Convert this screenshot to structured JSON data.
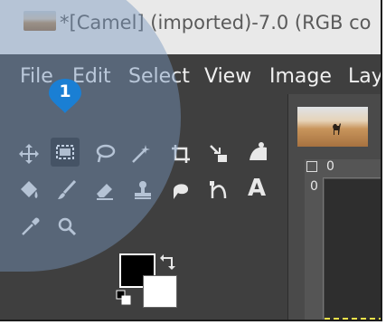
{
  "window": {
    "title": "*[Camel] (imported)-7.0 (RGB co",
    "thumbnail_icon": "camel-image-thumbnail"
  },
  "menubar": {
    "items": [
      "File",
      "Edit",
      "Select",
      "View",
      "Image",
      "Lay"
    ]
  },
  "annotation": {
    "step_number": "1",
    "color": "#1a7fd4"
  },
  "toolbox": {
    "tools": [
      {
        "name": "move-tool",
        "icon": "move-arrows-icon"
      },
      {
        "name": "rect-select-tool",
        "icon": "rect-select-icon",
        "selected": true
      },
      {
        "name": "free-select-tool",
        "icon": "lasso-icon"
      },
      {
        "name": "fuzzy-select-tool",
        "icon": "magic-wand-icon"
      },
      {
        "name": "crop-tool",
        "icon": "crop-icon"
      },
      {
        "name": "unified-transform-tool",
        "icon": "transform-icon"
      },
      {
        "name": "warp-transform-tool",
        "icon": "warp-icon"
      },
      {
        "name": "bucket-fill-tool",
        "icon": "bucket-icon"
      },
      {
        "name": "paintbrush-tool",
        "icon": "brush-icon"
      },
      {
        "name": "eraser-tool",
        "icon": "eraser-icon"
      },
      {
        "name": "clone-tool",
        "icon": "stamp-icon"
      },
      {
        "name": "smudge-tool",
        "icon": "smudge-icon"
      },
      {
        "name": "paths-tool",
        "icon": "paths-icon"
      },
      {
        "name": "text-tool",
        "icon": "text-icon"
      },
      {
        "name": "color-picker-tool",
        "icon": "eyedropper-icon"
      },
      {
        "name": "zoom-tool",
        "icon": "magnifier-icon"
      }
    ],
    "text_tool_glyph": "A",
    "foreground_color": "#000000",
    "background_color": "#ffffff"
  },
  "rulers": {
    "h_label": "0",
    "v_label": "0"
  },
  "colors": {
    "window_bg": "#3f3f3f",
    "titlebar_bg": "#e9e9e9",
    "canvas_border": "#f2e34a"
  }
}
